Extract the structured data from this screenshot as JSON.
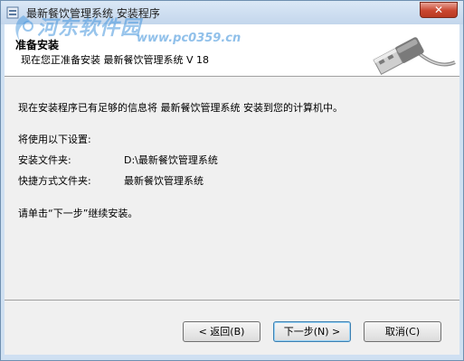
{
  "window": {
    "title": "最新餐饮管理系统 安装程序",
    "close_label": "✕"
  },
  "watermark": {
    "text": "河东软件园",
    "url": "www.pc0359.cn"
  },
  "header": {
    "title": "准备安装",
    "subtitle": "现在您正准备安装 最新餐饮管理系统 V 18"
  },
  "body": {
    "intro": "现在安装程序已有足够的信息将 最新餐饮管理系统 安装到您的计算机中。",
    "settings_heading": "将使用以下设置:",
    "install_folder_label": "安装文件夹:",
    "install_folder_value": "D:\\最新餐饮管理系统",
    "shortcut_folder_label": "快捷方式文件夹:",
    "shortcut_folder_value": "最新餐饮管理系统",
    "instruction": "请单击“下一步”继续安装。"
  },
  "buttons": {
    "back": "< 返回(B)",
    "next": "下一步(N) >",
    "cancel": "取消(C)"
  },
  "icons": {
    "title_icon": "installer-icon",
    "header_graphic": "usb-plug-icon"
  }
}
